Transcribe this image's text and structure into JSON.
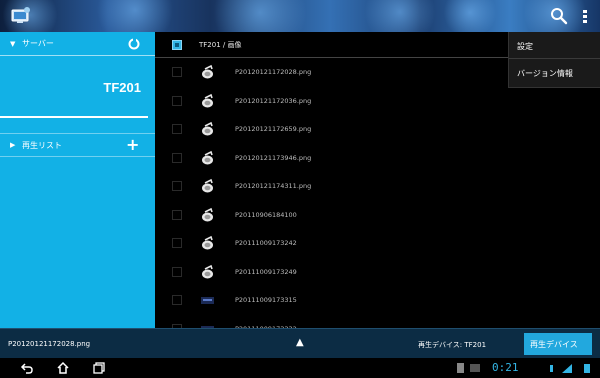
{
  "sidebar": {
    "server_label": "サーバー",
    "device_name": "TF201",
    "playlist_label": "再生リスト",
    "add_label": "+"
  },
  "file_list": {
    "path": "TF201 / 画像",
    "files": [
      "P20120121172028.png",
      "P20120121172036.png",
      "P20120121172659.png",
      "P20120121173946.png",
      "P20120121174311.png",
      "P20110906184100",
      "P20111009173242",
      "P20111009173249",
      "P20111009173315",
      "P20111009173332"
    ]
  },
  "menu": {
    "settings": "設定",
    "version_info": "バージョン情報"
  },
  "bottom": {
    "current_file": "P20120121172028.png",
    "play_device": "再生デバイス: TF201",
    "play_device_button": "再生デバイス"
  },
  "status": {
    "clock": "0:21"
  },
  "colors": {
    "accent": "#12b1e6",
    "bottom_bar": "#0c2c44",
    "clock": "#33b5e5"
  },
  "icons": [
    "app-icon",
    "search-icon",
    "overflow-icon",
    "refresh-icon",
    "back-icon",
    "home-icon",
    "recents-icon",
    "image-file-icon"
  ]
}
